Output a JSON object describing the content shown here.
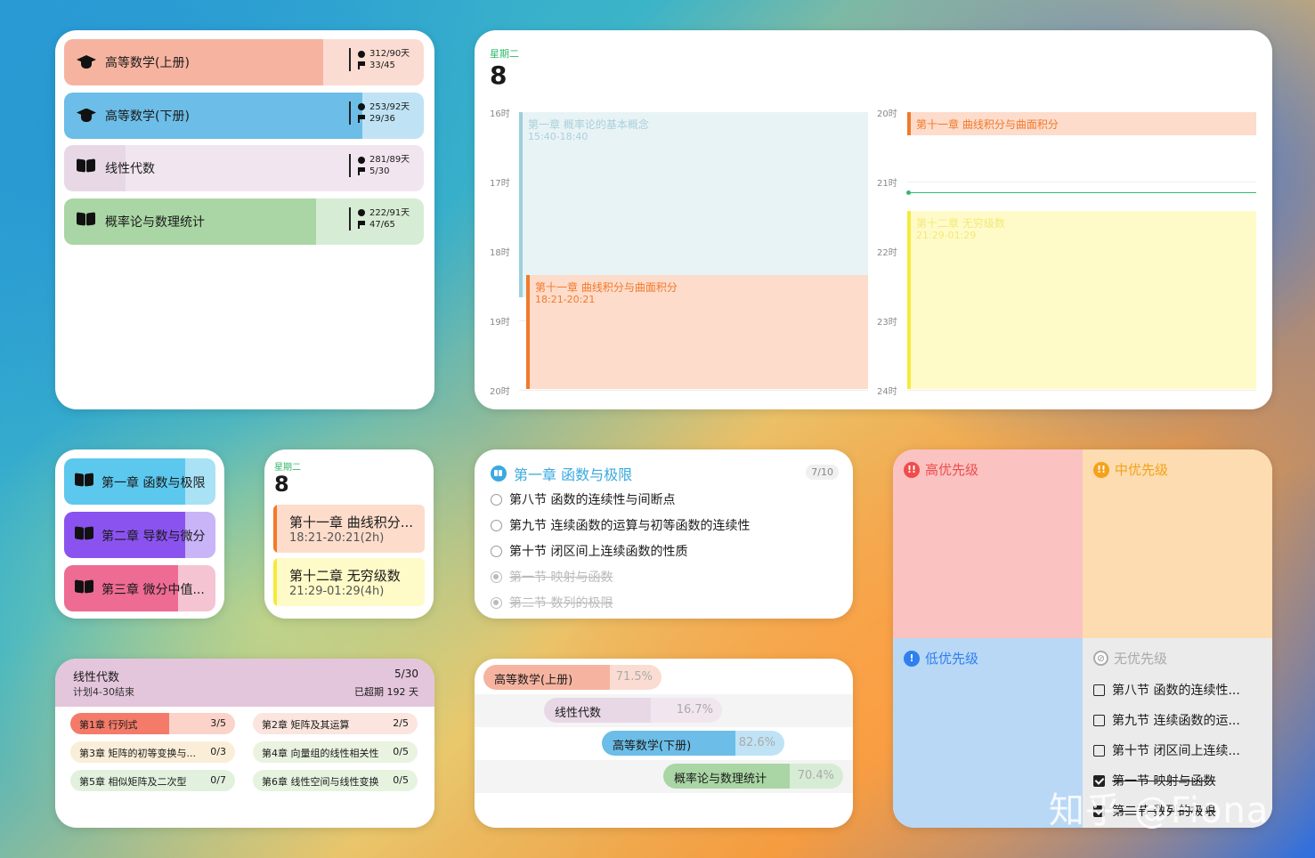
{
  "courses": [
    {
      "name": "高等数学(上册)",
      "days": "312/90天",
      "tasks": "33/45",
      "color": "#f6b4a0",
      "rest": "#fbdcd2",
      "pct": 0.72,
      "icon": "graduation-cap-icon"
    },
    {
      "name": "高等数学(下册)",
      "days": "253/92天",
      "tasks": "29/36",
      "color": "#6cbde7",
      "rest": "#bfe3f5",
      "pct": 0.83,
      "icon": "graduation-cap-icon"
    },
    {
      "name": "线性代数",
      "days": "281/89天",
      "tasks": "5/30",
      "color": "#e8d8e6",
      "rest": "#f1e6ef",
      "pct": 0.17,
      "icon": "book-icon"
    },
    {
      "name": "概率论与数理统计",
      "days": "222/91天",
      "tasks": "47/65",
      "color": "#a9d6a4",
      "rest": "#d7ecd4",
      "pct": 0.7,
      "icon": "book-icon"
    }
  ],
  "calendar": {
    "weekday": "星期二",
    "day": "8",
    "left_hours": [
      "16时",
      "17时",
      "18时",
      "19时",
      "20时"
    ],
    "right_hours": [
      "20时",
      "21时",
      "22时",
      "23时",
      "24时"
    ],
    "events": [
      {
        "title": "第一章 概率论的基本概念",
        "time": "15:40-18:40"
      },
      {
        "title": "第十一章 曲线积分与曲面积分",
        "time": "18:21-20:21"
      },
      {
        "title": "第十一章 曲线积分与曲面积分",
        "time": ""
      },
      {
        "title": "第十二章 无穷级数",
        "time": "21:29-01:29"
      }
    ]
  },
  "chapters": [
    {
      "name": "第一章 函数与极限",
      "color": "#5cc8ee",
      "rest": "#a9e1f5",
      "pct": 0.8
    },
    {
      "name": "第二章 导数与微分",
      "color": "#8a53f0",
      "rest": "#c8b4f7",
      "pct": 0.8
    },
    {
      "name": "第三章 微分中值...",
      "color": "#ee6b93",
      "rest": "#f5c4d2",
      "pct": 0.75
    }
  ],
  "small_cal": {
    "weekday": "星期二",
    "day": "8",
    "events": [
      {
        "title": "第十一章 曲线积分...",
        "time": "18:21-20:21(2h)"
      },
      {
        "title": "第十二章 无穷级数",
        "time": "21:29-01:29(4h)"
      }
    ]
  },
  "sections": {
    "title": "第一章 函数与极限",
    "count": "7/10",
    "items": [
      {
        "label": "第八节 函数的连续性与间断点",
        "done": false
      },
      {
        "label": "第九节 连续函数的运算与初等函数的连续性",
        "done": false
      },
      {
        "label": "第十节 闭区间上连续函数的性质",
        "done": false
      },
      {
        "label": "第一节 映射与函数",
        "done": true
      },
      {
        "label": "第二节 数列的极限",
        "done": true
      }
    ]
  },
  "plan": {
    "title": "线性代数",
    "count": "5/30",
    "subtitle": "计划4-30结束",
    "overdue": "已超期 192 天",
    "chapters": [
      {
        "name": "第1章 行列式",
        "count": "3/5",
        "pct": 0.6,
        "color": "#f47b6a",
        "rest": "#fbd3c9"
      },
      {
        "name": "第2章 矩阵及其运算",
        "count": "2/5",
        "pct": 0,
        "color": "#f6d3c8",
        "rest": "#fbe5de"
      },
      {
        "name": "第3章 矩阵的初等变换与...",
        "count": "0/3",
        "pct": 0,
        "color": "#fbeed8",
        "rest": "#fbeed8"
      },
      {
        "name": "第4章 向量组的线性相关性",
        "count": "0/5",
        "pct": 0,
        "color": "#e9f3e0",
        "rest": "#e9f3e0"
      },
      {
        "name": "第5章 相似矩阵及二次型",
        "count": "0/7",
        "pct": 0,
        "color": "#e2f1de",
        "rest": "#e2f1de"
      },
      {
        "name": "第6章 线性空间与线性变换",
        "count": "0/5",
        "pct": 0,
        "color": "#e6f3df",
        "rest": "#e6f3df"
      }
    ]
  },
  "progress": [
    {
      "name": "高等数学(上册)",
      "pct": "71.5%",
      "color": "#f6b4a0",
      "rest": "#fbdcd2"
    },
    {
      "name": "线性代数",
      "pct": "16.7%",
      "color": "#e8d8e6",
      "rest": "#f1e6ef"
    },
    {
      "name": "高等数学(下册)",
      "pct": "82.6%",
      "color": "#6cbde7",
      "rest": "#bfe3f5"
    },
    {
      "name": "概率论与数理统计",
      "pct": "70.4%",
      "color": "#a9d6a4",
      "rest": "#d7ecd4"
    }
  ],
  "priority": {
    "high": "高优先级",
    "medium": "中优先级",
    "low": "低优先级",
    "none": "无优先级",
    "none_items": [
      {
        "label": "第八节 函数的连续性...",
        "done": false
      },
      {
        "label": "第九节 连续函数的运...",
        "done": false
      },
      {
        "label": "第十节 闭区间上连续...",
        "done": false
      },
      {
        "label": "第一节 映射与函数",
        "done": true
      },
      {
        "label": "第二节 数列的极限",
        "done": true
      }
    ]
  },
  "watermark": "知乎 @Fiona"
}
